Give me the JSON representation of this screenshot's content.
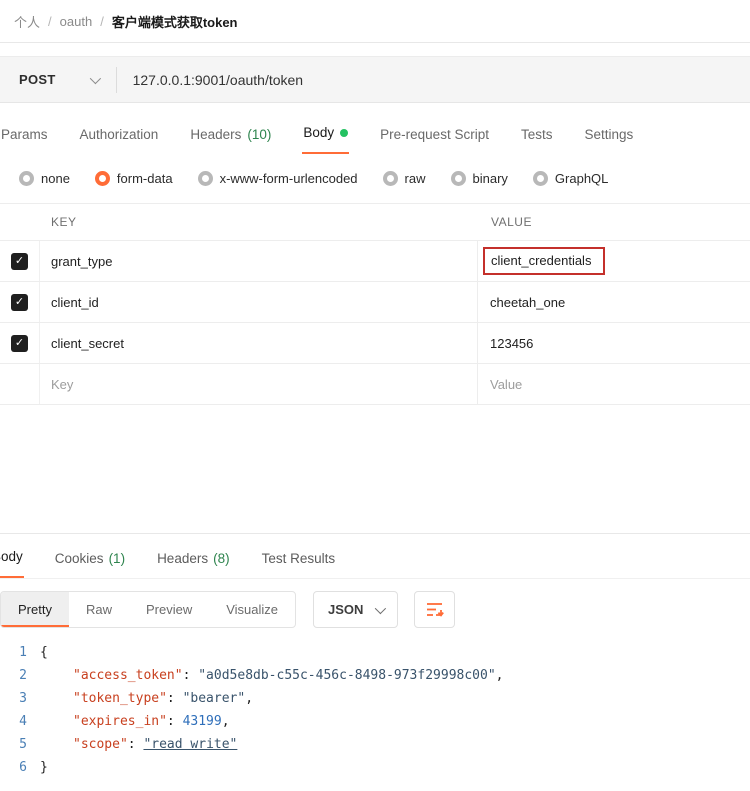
{
  "colors": {
    "accent_orange": "#ff6c37",
    "body_dot_green": "#23c161",
    "count_green": "#2e844e",
    "annotation_red": "#c4302b",
    "json_key": "#c8401f",
    "json_string": "#39536b",
    "json_number": "#2f6fba",
    "line_number_blue": "#4a7fb5"
  },
  "breadcrumb": {
    "part1": "个人",
    "sep1": "/",
    "part2": "oauth",
    "sep2": "/",
    "current": "客户端模式获取token"
  },
  "request": {
    "method": "POST",
    "url": "127.0.0.1:9001/oauth/token"
  },
  "request_tabs": [
    {
      "label": "Params"
    },
    {
      "label": "Authorization"
    },
    {
      "label": "Headers",
      "count": "(10)"
    },
    {
      "label": "Body"
    },
    {
      "label": "Pre-request Script"
    },
    {
      "label": "Tests"
    },
    {
      "label": "Settings"
    }
  ],
  "body_types": [
    {
      "label": "none"
    },
    {
      "label": "form-data"
    },
    {
      "label": "x-www-form-urlencoded"
    },
    {
      "label": "raw"
    },
    {
      "label": "binary"
    },
    {
      "label": "GraphQL"
    }
  ],
  "body_table": {
    "headers": {
      "key": "KEY",
      "value": "VALUE"
    },
    "rows": [
      {
        "key": "grant_type",
        "value": "client_credentials"
      },
      {
        "key": "client_id",
        "value": "cheetah_one"
      },
      {
        "key": "client_secret",
        "value": "123456"
      }
    ],
    "placeholder_row": {
      "key": "Key",
      "value": "Value"
    }
  },
  "response": {
    "tabs": [
      {
        "label": "Body"
      },
      {
        "label": "Cookies",
        "count": "(1)"
      },
      {
        "label": "Headers",
        "count": "(8)"
      },
      {
        "label": "Test Results"
      }
    ],
    "view_tabs": [
      {
        "label": "Pretty"
      },
      {
        "label": "Raw"
      },
      {
        "label": "Preview"
      },
      {
        "label": "Visualize"
      }
    ],
    "format_select": "JSON",
    "code": {
      "lines": [
        {
          "num": "1",
          "text": "{"
        },
        {
          "num": "2",
          "key": "\"access_token\"",
          "sep": ": ",
          "value": "\"a0d5e8db-c55c-456c-8498-973f29998c00\"",
          "end": ","
        },
        {
          "num": "3",
          "key": "\"token_type\"",
          "sep": ": ",
          "value": "\"bearer\"",
          "end": ","
        },
        {
          "num": "4",
          "key": "\"expires_in\"",
          "sep": ": ",
          "value": "43199",
          "end": ","
        },
        {
          "num": "5",
          "key": "\"scope\"",
          "sep": ": ",
          "value": "\"read write\"",
          "end": ""
        },
        {
          "num": "6",
          "text": "}"
        }
      ]
    }
  }
}
